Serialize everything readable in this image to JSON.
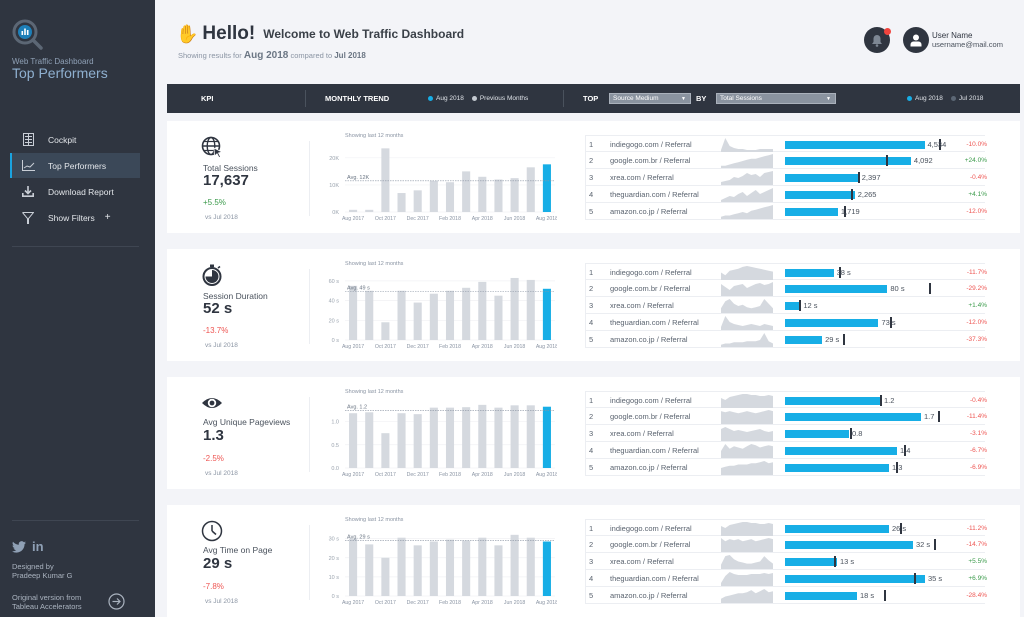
{
  "sidebar": {
    "brand_sub": "Web Traffic Dashboard",
    "brand_title": "Top Performers",
    "logo_icon": "magnifier-chart-icon",
    "items": [
      {
        "label": "Cockpit",
        "icon": "grid-icon",
        "active": false
      },
      {
        "label": "Top Performers",
        "icon": "line-chart-icon",
        "active": true
      },
      {
        "label": "Download Report",
        "icon": "download-icon",
        "active": false
      },
      {
        "label": "Show Filters",
        "icon": "filter-icon",
        "active": false,
        "suffix": "+"
      }
    ],
    "social": [
      "twitter-icon",
      "linkedin-icon"
    ],
    "linkedin_label": "in",
    "designed_line1": "Designed by",
    "designed_line2": "Pradeep Kumar G",
    "original_line1": "Original version from",
    "original_line2": "Tableau Accelerators"
  },
  "header": {
    "greeting_icon": "waving-hand-icon",
    "greeting": "Hello!",
    "welcome": "Welcome to Web Traffic Dashboard",
    "subtitle_prefix": "Showing results for",
    "current_period": "Aug 2018",
    "subtitle_mid": "compared to",
    "compare_period": "Jul 2018",
    "user_name": "User Name",
    "user_email": "username@mail.com"
  },
  "table_header": {
    "kpi": "KPI",
    "monthly_trend": "MONTHLY TREND",
    "legend_current": "Aug 2018",
    "legend_previous": "Previous Months",
    "top": "TOP",
    "top_select": "Source Medium",
    "by": "BY",
    "by_select": "Total Sessions",
    "legend_right_current": "Aug 2018",
    "legend_right_previous": "Jul 2018"
  },
  "colors": {
    "accent": "#17aee6",
    "bar_previous": "#d5d9df",
    "positive": "#3a9a4a",
    "negative": "#ee5552",
    "sidebar_bg": "#2f3540"
  },
  "chart_note": "Showing last 12 months",
  "kpis": [
    {
      "icon": "globe-cursor-icon",
      "label": "Total Sessions",
      "value": "17,637",
      "change": "+5.5%",
      "change_dir": "pos",
      "vs": "vs Jul 2018",
      "chart": {
        "avg_label": "Avg. 12K",
        "avg": 11.5,
        "ymax": 24,
        "yticks": [
          {
            "v": 0,
            "l": "0K"
          },
          {
            "v": 10,
            "l": "10K"
          },
          {
            "v": 20,
            "l": "20K"
          }
        ],
        "values": [
          0.8,
          0.8,
          23.5,
          7,
          8,
          11.5,
          11,
          15,
          13,
          12,
          12.5,
          16.5,
          17.6
        ]
      },
      "rows": [
        {
          "rank": "1",
          "source": "indiegogo.com / Referral",
          "value": "4,534",
          "cur": 4534,
          "prev": 5038,
          "pct": "-10.0%",
          "dir": "neg",
          "spark": [
            2,
            14,
            6,
            4,
            3,
            3,
            2,
            2,
            2,
            3,
            3,
            3,
            3
          ]
        },
        {
          "rank": "2",
          "source": "google.com.br / Referral",
          "value": "4,092",
          "cur": 4092,
          "prev": 3300,
          "pct": "+24.0%",
          "dir": "pos",
          "spark": [
            2,
            2,
            3,
            4,
            5,
            6,
            7,
            8,
            8,
            9,
            10,
            11,
            12
          ]
        },
        {
          "rank": "3",
          "source": "xrea.com / Referral",
          "value": "2,397",
          "cur": 2397,
          "prev": 2407,
          "pct": "-0.4%",
          "dir": "neg",
          "spark": [
            3,
            4,
            5,
            8,
            7,
            9,
            12,
            10,
            11,
            8,
            12,
            13,
            14
          ]
        },
        {
          "rank": "4",
          "source": "theguardian.com / Referral",
          "value": "2,265",
          "cur": 2265,
          "prev": 2176,
          "pct": "+4.1%",
          "dir": "pos",
          "spark": [
            2,
            4,
            6,
            5,
            8,
            10,
            6,
            9,
            12,
            8,
            10,
            12,
            14
          ]
        },
        {
          "rank": "5",
          "source": "amazon.co.jp / Referral",
          "value": "1,719",
          "cur": 1719,
          "prev": 1953,
          "pct": "-12.0%",
          "dir": "neg",
          "spark": [
            2,
            3,
            3,
            4,
            5,
            6,
            5,
            7,
            8,
            9,
            10,
            11,
            12
          ]
        }
      ],
      "max": 5200
    },
    {
      "icon": "stopwatch-icon",
      "label": "Session Duration",
      "value": "52 s",
      "change": "-13.7%",
      "change_dir": "neg",
      "vs": "vs Jul 2018",
      "chart": {
        "avg_label": "Avg. 49 s",
        "avg": 49,
        "ymax": 66,
        "yticks": [
          {
            "v": 0,
            "l": "0 s"
          },
          {
            "v": 20,
            "l": "20 s"
          },
          {
            "v": 40,
            "l": "40 s"
          },
          {
            "v": 60,
            "l": "60 s"
          }
        ],
        "values": [
          55,
          50,
          18,
          50,
          38,
          47,
          50,
          53,
          59,
          45,
          63,
          61,
          52
        ]
      },
      "rows": [
        {
          "rank": "1",
          "source": "indiegogo.com / Referral",
          "value": "38 s",
          "cur": 38,
          "prev": 43,
          "pct": "-11.7%",
          "dir": "neg",
          "spark": [
            8,
            5,
            10,
            11,
            12,
            14,
            15,
            14,
            13,
            12,
            11,
            10,
            9
          ]
        },
        {
          "rank": "2",
          "source": "google.com.br / Referral",
          "value": "80 s",
          "cur": 80,
          "prev": 113,
          "pct": "-29.2%",
          "dir": "neg",
          "spark": [
            12,
            9,
            6,
            10,
            11,
            12,
            8,
            10,
            12,
            13,
            11,
            12,
            14
          ]
        },
        {
          "rank": "3",
          "source": "xrea.com / Referral",
          "value": "12 s",
          "cur": 12,
          "prev": 11.8,
          "pct": "+1.4%",
          "dir": "pos",
          "spark": [
            4,
            10,
            12,
            8,
            6,
            7,
            5,
            4,
            5,
            6,
            12,
            8,
            4
          ]
        },
        {
          "rank": "4",
          "source": "theguardian.com / Referral",
          "value": "73 s",
          "cur": 73,
          "prev": 83,
          "pct": "-12.0%",
          "dir": "neg",
          "spark": [
            3,
            14,
            8,
            6,
            5,
            4,
            5,
            6,
            5,
            4,
            6,
            5,
            4
          ]
        },
        {
          "rank": "5",
          "source": "amazon.co.jp / Referral",
          "value": "29 s",
          "cur": 29,
          "prev": 46,
          "pct": "-37.3%",
          "dir": "neg",
          "spark": [
            2,
            3,
            3,
            4,
            4,
            4,
            5,
            5,
            5,
            6,
            12,
            5,
            3
          ]
        }
      ],
      "max": 125
    },
    {
      "icon": "eye-icon",
      "label": "Avg Unique Pageviews",
      "value": "1.3",
      "change": "-2.5%",
      "change_dir": "neg",
      "vs": "vs Jul 2018",
      "chart": {
        "avg_label": "Avg. 1.2",
        "avg": 1.24,
        "ymax": 1.4,
        "yticks": [
          {
            "v": 0,
            "l": "0.0"
          },
          {
            "v": 0.5,
            "l": "0.5"
          },
          {
            "v": 1.0,
            "l": "1.0"
          }
        ],
        "values": [
          1.18,
          1.2,
          0.75,
          1.18,
          1.16,
          1.3,
          1.3,
          1.31,
          1.36,
          1.3,
          1.35,
          1.35,
          1.32
        ]
      },
      "rows": [
        {
          "rank": "1",
          "source": "indiegogo.com / Referral",
          "value": "1.2",
          "cur": 1.2,
          "prev": 1.2,
          "pct": "-0.4%",
          "dir": "neg",
          "spark": [
            10,
            8,
            11,
            12,
            13,
            14,
            14,
            13,
            13,
            12,
            12,
            13,
            12
          ]
        },
        {
          "rank": "2",
          "source": "google.com.br / Referral",
          "value": "1.7",
          "cur": 1.7,
          "prev": 1.92,
          "pct": "-11.4%",
          "dir": "neg",
          "spark": [
            12,
            11,
            12,
            11,
            10,
            11,
            12,
            11,
            10,
            11,
            12,
            13,
            12
          ]
        },
        {
          "rank": "3",
          "source": "xrea.com / Referral",
          "value": "0.8",
          "cur": 0.8,
          "prev": 0.82,
          "pct": "-3.1%",
          "dir": "neg",
          "spark": [
            12,
            14,
            12,
            10,
            11,
            10,
            9,
            10,
            11,
            12,
            10,
            9,
            10
          ]
        },
        {
          "rank": "4",
          "source": "theguardian.com / Referral",
          "value": "1.4",
          "cur": 1.4,
          "prev": 1.5,
          "pct": "-6.7%",
          "dir": "neg",
          "spark": [
            6,
            12,
            8,
            10,
            9,
            8,
            10,
            12,
            11,
            9,
            10,
            11,
            10
          ]
        },
        {
          "rank": "5",
          "source": "amazon.co.jp / Referral",
          "value": "1.3",
          "cur": 1.3,
          "prev": 1.4,
          "pct": "-6.9%",
          "dir": "neg",
          "spark": [
            6,
            7,
            8,
            8,
            9,
            9,
            9,
            10,
            10,
            11,
            12,
            10,
            11
          ]
        }
      ],
      "max": 2.0
    },
    {
      "icon": "clock-icon",
      "label": "Avg Time on Page",
      "value": "29 s",
      "change": "-7.8%",
      "change_dir": "neg",
      "vs": "vs Jul 2018",
      "chart": {
        "avg_label": "Avg. 29 s",
        "avg": 29,
        "ymax": 34,
        "yticks": [
          {
            "v": 0,
            "l": "0 s"
          },
          {
            "v": 10,
            "l": "10 s"
          },
          {
            "v": 20,
            "l": "20 s"
          },
          {
            "v": 30,
            "l": "30 s"
          }
        ],
        "values": [
          30,
          27,
          20,
          30.5,
          26.5,
          28.5,
          29.5,
          29,
          30.5,
          26.5,
          32,
          30.5,
          28.5
        ]
      },
      "rows": [
        {
          "rank": "1",
          "source": "indiegogo.com / Referral",
          "value": "26 s",
          "cur": 26,
          "prev": 29,
          "pct": "-11.2%",
          "dir": "neg",
          "spark": [
            10,
            8,
            11,
            12,
            13,
            14,
            14,
            13,
            13,
            12,
            12,
            13,
            12
          ]
        },
        {
          "rank": "2",
          "source": "google.com.br / Referral",
          "value": "32 s",
          "cur": 32,
          "prev": 37.5,
          "pct": "-14.7%",
          "dir": "neg",
          "spark": [
            13,
            10,
            12,
            11,
            12,
            10,
            11,
            12,
            10,
            11,
            12,
            13,
            12
          ]
        },
        {
          "rank": "3",
          "source": "xrea.com / Referral",
          "value": "13 s",
          "cur": 13,
          "prev": 12.5,
          "pct": "+5.5%",
          "dir": "pos",
          "spark": [
            4,
            12,
            13,
            9,
            7,
            6,
            5,
            5,
            6,
            7,
            12,
            8,
            5
          ]
        },
        {
          "rank": "4",
          "source": "theguardian.com / Referral",
          "value": "35 s",
          "cur": 35,
          "prev": 32.5,
          "pct": "+6.9%",
          "dir": "pos",
          "spark": [
            3,
            10,
            14,
            12,
            11,
            11,
            11,
            12,
            12,
            12,
            13,
            12,
            13
          ]
        },
        {
          "rank": "5",
          "source": "amazon.co.jp / Referral",
          "value": "18 s",
          "cur": 18,
          "prev": 25,
          "pct": "-28.4%",
          "dir": "neg",
          "spark": [
            4,
            6,
            7,
            8,
            9,
            9,
            10,
            12,
            9,
            11,
            13,
            10,
            11
          ]
        }
      ],
      "max": 40
    }
  ],
  "chart_data": [
    {
      "type": "bar",
      "title": "Total Sessions - Showing last 12 months",
      "categories": [
        "Aug 2017",
        "Sep 2017",
        "Oct 2017",
        "Nov 2017",
        "Dec 2017",
        "Jan 2018",
        "Feb 2018",
        "Mar 2018",
        "Apr 2018",
        "May 2018",
        "Jun 2018",
        "Jul 2018",
        "Aug 2018"
      ],
      "xtick_labels": [
        "Aug 2017",
        "Oct 2017",
        "Dec 2017",
        "Feb 2018",
        "Apr 2018",
        "Jun 2018",
        "Aug 2018"
      ],
      "values": [
        800,
        800,
        23500,
        7000,
        8000,
        11500,
        11000,
        15000,
        13000,
        12000,
        12500,
        16500,
        17637
      ],
      "ylabel": "",
      "xlabel": "",
      "ylim": [
        0,
        24000
      ],
      "yticks": [
        "0K",
        "10K",
        "20K"
      ],
      "reference_line": {
        "label": "Avg. 12K",
        "value": 11500
      },
      "highlight": "Aug 2018"
    },
    {
      "type": "bar",
      "title": "Session Duration - Showing last 12 months",
      "categories": [
        "Aug 2017",
        "Sep 2017",
        "Oct 2017",
        "Nov 2017",
        "Dec 2017",
        "Jan 2018",
        "Feb 2018",
        "Mar 2018",
        "Apr 2018",
        "May 2018",
        "Jun 2018",
        "Jul 2018",
        "Aug 2018"
      ],
      "values": [
        55,
        50,
        18,
        50,
        38,
        47,
        50,
        53,
        59,
        45,
        63,
        61,
        52
      ],
      "ylim": [
        0,
        66
      ],
      "yticks": [
        "0 s",
        "20 s",
        "40 s",
        "60 s"
      ],
      "reference_line": {
        "label": "Avg. 49 s",
        "value": 49
      },
      "highlight": "Aug 2018"
    },
    {
      "type": "bar",
      "title": "Avg Unique Pageviews - Showing last 12 months",
      "categories": [
        "Aug 2017",
        "Sep 2017",
        "Oct 2017",
        "Nov 2017",
        "Dec 2017",
        "Jan 2018",
        "Feb 2018",
        "Mar 2018",
        "Apr 2018",
        "May 2018",
        "Jun 2018",
        "Jul 2018",
        "Aug 2018"
      ],
      "values": [
        1.18,
        1.2,
        0.75,
        1.18,
        1.16,
        1.3,
        1.3,
        1.31,
        1.36,
        1.3,
        1.35,
        1.35,
        1.32
      ],
      "ylim": [
        0,
        1.4
      ],
      "yticks": [
        "0.0",
        "0.5",
        "1.0"
      ],
      "reference_line": {
        "label": "Avg. 1.2",
        "value": 1.24
      },
      "highlight": "Aug 2018"
    },
    {
      "type": "bar",
      "title": "Avg Time on Page - Showing last 12 months",
      "categories": [
        "Aug 2017",
        "Sep 2017",
        "Oct 2017",
        "Nov 2017",
        "Dec 2017",
        "Jan 2018",
        "Feb 2018",
        "Mar 2018",
        "Apr 2018",
        "May 2018",
        "Jun 2018",
        "Jul 2018",
        "Aug 2018"
      ],
      "values": [
        30,
        27,
        20,
        30.5,
        26.5,
        28.5,
        29.5,
        29,
        30.5,
        26.5,
        32,
        30.5,
        28.5
      ],
      "ylim": [
        0,
        34
      ],
      "yticks": [
        "0 s",
        "10 s",
        "20 s",
        "30 s"
      ],
      "reference_line": {
        "label": "Avg. 29 s",
        "value": 29
      },
      "highlight": "Aug 2018"
    }
  ],
  "xtick_labels": [
    "Aug 2017",
    "Oct 2017",
    "Dec 2017",
    "Feb 2018",
    "Apr 2018",
    "Jun 2018",
    "Aug 2018"
  ]
}
